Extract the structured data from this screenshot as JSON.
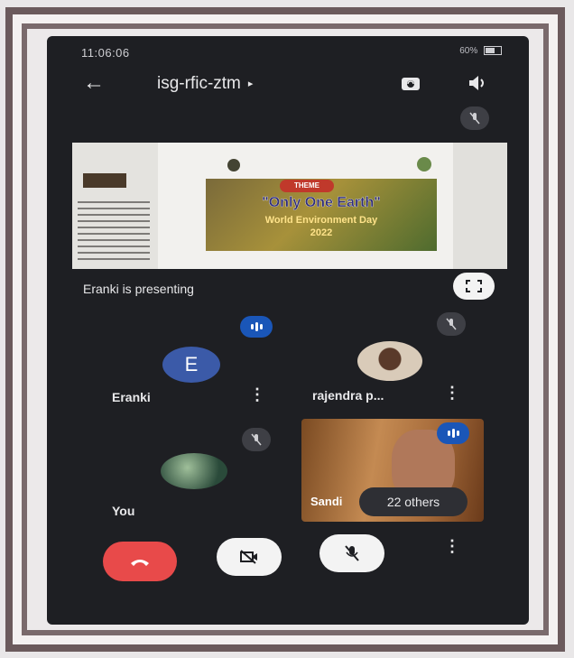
{
  "status_bar": {
    "time": "11:06:06",
    "battery": "60%"
  },
  "header": {
    "meeting_code": "isg-rfic-ztm",
    "caret": "▸",
    "back_icon": "←"
  },
  "presentation": {
    "theme_label": "THEME",
    "slide_title": "\"Only One Earth\"",
    "slide_subtitle": "World Environment Day",
    "slide_year": "2022",
    "presenting_text": "Eranki is presenting"
  },
  "participants": [
    {
      "name": "Eranki",
      "initial": "E",
      "avatar_color": "#3b5aa8"
    },
    {
      "name": "rajendra p..."
    },
    {
      "name": "You"
    },
    {
      "name": "Sandi"
    }
  ],
  "others_label": "22 others",
  "colors": {
    "speaking": "#1a56b8",
    "end_call": "#e84a4a",
    "background": "#1e1f23"
  }
}
